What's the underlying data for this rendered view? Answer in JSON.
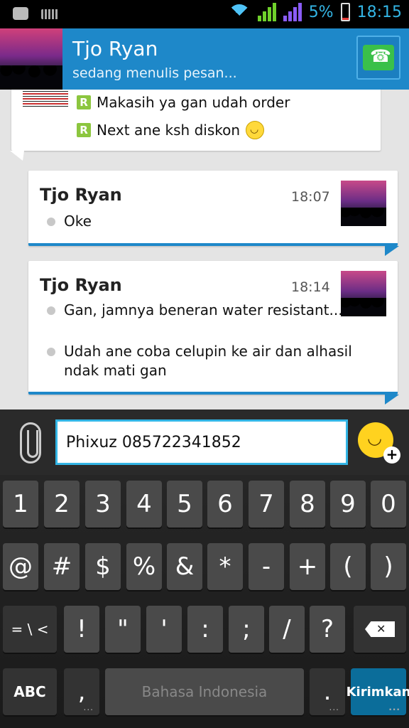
{
  "status_bar": {
    "battery": "5%",
    "time": "18:15",
    "icons": [
      "bbm-icon",
      "keyboard-icon",
      "wifi-icon",
      "signal-green-icon",
      "signal-purple-icon",
      "battery-icon"
    ]
  },
  "header": {
    "name": "Tjo Ryan",
    "status": "sedang menulis pesan..."
  },
  "chat": {
    "top_bubble_lines": [
      "Makasih ya gan udah order",
      "Next ane ksh diskon"
    ],
    "messages": [
      {
        "sender": "Tjo Ryan",
        "time": "18:07",
        "lines": [
          "Oke"
        ]
      },
      {
        "sender": "Tjo Ryan",
        "time": "18:14",
        "lines": [
          "Gan, jamnya beneran water resistant...",
          "Udah ane coba celupin ke air dan alhasil ndak mati gan"
        ]
      }
    ]
  },
  "input": {
    "value": "Phixuz 085722341852"
  },
  "keyboard": {
    "row1": [
      "1",
      "2",
      "3",
      "4",
      "5",
      "6",
      "7",
      "8",
      "9",
      "0"
    ],
    "row2": [
      "@",
      "#",
      "$",
      "%",
      "&",
      "*",
      "-",
      "+",
      "(",
      ")"
    ],
    "row3": [
      "= \\ <",
      "!",
      "\"",
      "'",
      ":",
      ";",
      "/",
      "?"
    ],
    "abc": "ABC",
    "comma": ",",
    "space": "Bahasa Indonesia",
    "period": ".",
    "send": "Kirimkan"
  }
}
